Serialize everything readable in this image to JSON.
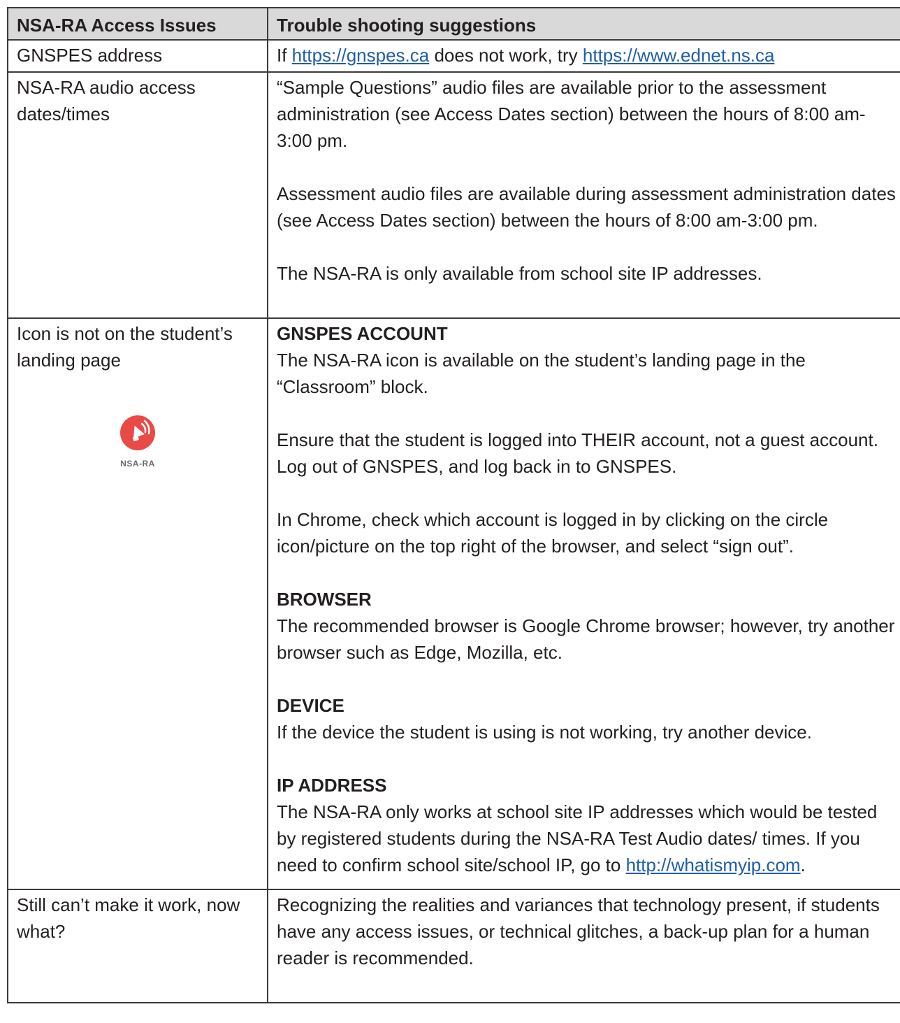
{
  "table": {
    "header": {
      "col1": "NSA-RA Access Issues",
      "col2": "Trouble shooting suggestions"
    },
    "rows": [
      {
        "issue": "GNSPES address",
        "prefix": "If ",
        "link1": "https://gnspes.ca",
        "middle": " does not work, try ",
        "link2": "https://www.ednet.ns.ca"
      },
      {
        "issue": "NSA-RA audio access dates/times",
        "paragraphs": [
          "“Sample Questions” audio files are available prior to the assessment administration (see Access Dates section) between the hours of 8:00 am-3:00 pm.",
          "Assessment audio files are available during assessment administration dates (see Access Dates section) between the hours of 8:00 am-3:00 pm.",
          "The NSA-RA is only available from school site IP addresses."
        ]
      },
      {
        "issue": "Icon is not on the student’s landing page",
        "icon_caption": "NSA-RA",
        "icon": "speaker-megaphone-icon",
        "icon_color": "#e94a45",
        "sections": {
          "account_heading": "GNSPES ACCOUNT",
          "account_p1": "The NSA-RA icon is available on the student’s landing page in the “Classroom” block.",
          "account_p2": "Ensure that the student is logged into THEIR account, not a guest account. Log out of GNSPES, and log back in to GNSPES.",
          "account_p3": "In Chrome, check which account is logged in by clicking on the circle icon/picture on the top right of the browser, and select “sign out”.",
          "browser_heading": "BROWSER",
          "browser_p": "The recommended browser is Google Chrome browser; however, try another browser such as Edge, Mozilla, etc.",
          "device_heading": "DEVICE",
          "device_p": "If the device the student is using is not working, try another device.",
          "ip_heading": "IP ADDRESS",
          "ip_p": "The NSA-RA only works at school site IP addresses which would be tested by registered students during the NSA-RA Test Audio dates/ times. If you need to confirm school site/school IP, go to ",
          "ip_link": "http://whatismyip.com",
          "ip_end": "."
        }
      },
      {
        "issue": "Still can’t make it work, now what?",
        "text": "Recognizing the realities and variances that technology present, if students have any access issues, or technical glitches, a back-up plan for a human reader is recommended."
      }
    ]
  },
  "colors": {
    "header_bg": "#d9d9d9",
    "link": "#1f5ea8",
    "border": "#3a3a3a"
  }
}
